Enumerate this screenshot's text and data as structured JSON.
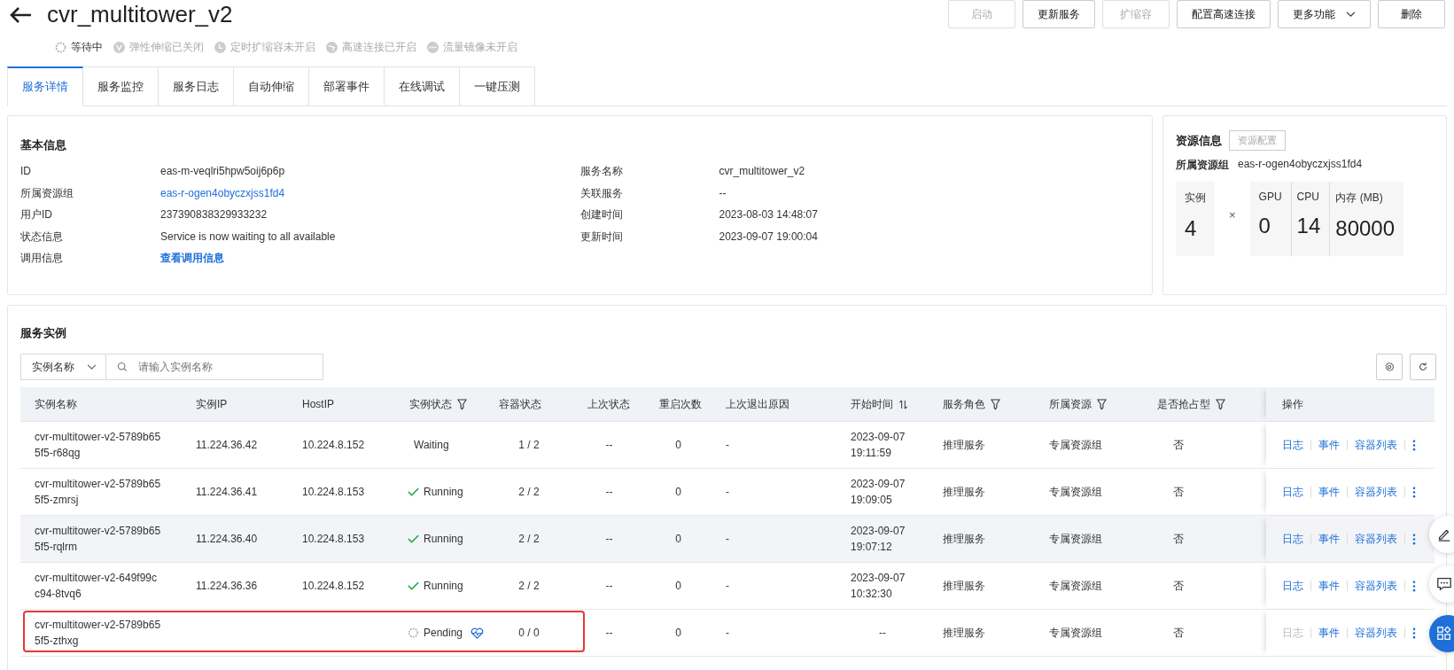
{
  "header": {
    "title": "cvr_multitower_v2",
    "actions": [
      {
        "label": "启动",
        "disabled": true,
        "kind": "button"
      },
      {
        "label": "更新服务",
        "disabled": false,
        "kind": "button"
      },
      {
        "label": "扩缩容",
        "disabled": true,
        "kind": "button"
      },
      {
        "label": "配置高速连接",
        "disabled": false,
        "kind": "button"
      },
      {
        "label": "更多功能",
        "disabled": false,
        "kind": "dropdown"
      },
      {
        "label": "删除",
        "disabled": false,
        "kind": "button"
      }
    ],
    "badges": [
      {
        "label": "等待中",
        "kind": "loading",
        "active": true
      },
      {
        "label": "弹性伸缩已关闭",
        "kind": "scaling",
        "active": false
      },
      {
        "label": "定时扩缩容未开启",
        "kind": "timer",
        "active": false
      },
      {
        "label": "高速连接已开启",
        "kind": "link",
        "active": false
      },
      {
        "label": "流量镜像未开启",
        "kind": "mirror",
        "active": false
      }
    ]
  },
  "tabs": [
    {
      "label": "服务详情",
      "selected": true
    },
    {
      "label": "服务监控",
      "selected": false
    },
    {
      "label": "服务日志",
      "selected": false
    },
    {
      "label": "自动伸缩",
      "selected": false
    },
    {
      "label": "部署事件",
      "selected": false
    },
    {
      "label": "在线调试",
      "selected": false
    },
    {
      "label": "一键压测",
      "selected": false
    }
  ],
  "basic_info": {
    "title": "基本信息",
    "left": [
      {
        "label": "ID",
        "value": "eas-m-veqlri5hpw5oij6p6p",
        "kind": "text"
      },
      {
        "label": "所属资源组",
        "value": "eas-r-ogen4obyczxjss1fd4",
        "kind": "link"
      },
      {
        "label": "用户ID",
        "value": "237390838329933232",
        "kind": "text"
      },
      {
        "label": "状态信息",
        "value": "Service is now waiting to all available",
        "kind": "text"
      },
      {
        "label": "调用信息",
        "value": "查看调用信息",
        "kind": "action"
      }
    ],
    "right": [
      {
        "label": "服务名称",
        "value": "cvr_multitower_v2",
        "kind": "text"
      },
      {
        "label": "关联服务",
        "value": "--",
        "kind": "text"
      },
      {
        "label": "创建时间",
        "value": "2023-08-03 14:48:07",
        "kind": "text"
      },
      {
        "label": "更新时间",
        "value": "2023-09-07 19:00:04",
        "kind": "text"
      }
    ]
  },
  "resource_info": {
    "title": "资源信息",
    "config_button": {
      "label": "资源配置",
      "disabled": true
    },
    "group_label": "所属资源组",
    "group_value": "eas-r-ogen4obyczxjss1fd4",
    "instances": {
      "label": "实例",
      "value": "4"
    },
    "multiply": "×",
    "specs": [
      {
        "label": "GPU",
        "value": "0"
      },
      {
        "label": "CPU",
        "value": "14"
      },
      {
        "label": "内存 (MB)",
        "value": "80000"
      }
    ]
  },
  "instances": {
    "title": "服务实例",
    "filter_select": "实例名称",
    "search_placeholder": "请输入实例名称",
    "columns": [
      {
        "label": "实例名称",
        "filter": false,
        "sort": false
      },
      {
        "label": "实例IP",
        "filter": false,
        "sort": false
      },
      {
        "label": "HostIP",
        "filter": false,
        "sort": false
      },
      {
        "label": "实例状态",
        "filter": true,
        "sort": false
      },
      {
        "label": "容器状态",
        "filter": false,
        "sort": false
      },
      {
        "label": "上次状态",
        "filter": false,
        "sort": false
      },
      {
        "label": "重启次数",
        "filter": false,
        "sort": false
      },
      {
        "label": "上次退出原因",
        "filter": false,
        "sort": false
      },
      {
        "label": "开始时间",
        "filter": false,
        "sort": true
      },
      {
        "label": "服务角色",
        "filter": true,
        "sort": false
      },
      {
        "label": "所属资源",
        "filter": true,
        "sort": false
      },
      {
        "label": "是否抢占型",
        "filter": true,
        "sort": false
      }
    ],
    "action_column": "操作",
    "rows": [
      {
        "name": "cvr-multitower-v2-5789b655f5-r68qg",
        "ip": "11.224.36.42",
        "host_ip": "10.224.8.152",
        "status": {
          "kind": "waiting",
          "label": "Waiting"
        },
        "health_icon": false,
        "containers": "1 / 2",
        "last_status": "--",
        "restarts": "0",
        "exit_reason": "-",
        "start_time": "2023-09-07 19:11:59",
        "role": "推理服务",
        "resource": "专属资源组",
        "preemptible": "否",
        "hovered": false,
        "highlighted": false,
        "actions": [
          {
            "label": "日志",
            "disabled": false
          },
          {
            "label": "事件",
            "disabled": false
          },
          {
            "label": "容器列表",
            "disabled": false
          }
        ]
      },
      {
        "name": "cvr-multitower-v2-5789b655f5-zmrsj",
        "ip": "11.224.36.41",
        "host_ip": "10.224.8.153",
        "status": {
          "kind": "running",
          "label": "Running"
        },
        "health_icon": false,
        "containers": "2 / 2",
        "last_status": "--",
        "restarts": "0",
        "exit_reason": "-",
        "start_time": "2023-09-07 19:09:05",
        "role": "推理服务",
        "resource": "专属资源组",
        "preemptible": "否",
        "hovered": false,
        "highlighted": false,
        "actions": [
          {
            "label": "日志",
            "disabled": false
          },
          {
            "label": "事件",
            "disabled": false
          },
          {
            "label": "容器列表",
            "disabled": false
          }
        ]
      },
      {
        "name": "cvr-multitower-v2-5789b655f5-rqlrm",
        "ip": "11.224.36.40",
        "host_ip": "10.224.8.153",
        "status": {
          "kind": "running",
          "label": "Running"
        },
        "health_icon": false,
        "containers": "2 / 2",
        "last_status": "--",
        "restarts": "0",
        "exit_reason": "-",
        "start_time": "2023-09-07 19:07:12",
        "role": "推理服务",
        "resource": "专属资源组",
        "preemptible": "否",
        "hovered": true,
        "highlighted": false,
        "actions": [
          {
            "label": "日志",
            "disabled": false
          },
          {
            "label": "事件",
            "disabled": false
          },
          {
            "label": "容器列表",
            "disabled": false
          }
        ]
      },
      {
        "name": "cvr-multitower-v2-649f99cc94-8tvq6",
        "ip": "11.224.36.36",
        "host_ip": "10.224.8.152",
        "status": {
          "kind": "running",
          "label": "Running"
        },
        "health_icon": false,
        "containers": "2 / 2",
        "last_status": "--",
        "restarts": "0",
        "exit_reason": "-",
        "start_time": "2023-09-07 10:32:30",
        "role": "推理服务",
        "resource": "专属资源组",
        "preemptible": "否",
        "hovered": false,
        "highlighted": false,
        "actions": [
          {
            "label": "日志",
            "disabled": false
          },
          {
            "label": "事件",
            "disabled": false
          },
          {
            "label": "容器列表",
            "disabled": false
          }
        ]
      },
      {
        "name": "cvr-multitower-v2-5789b655f5-zthxg",
        "ip": "",
        "host_ip": "",
        "status": {
          "kind": "pending",
          "label": "Pending"
        },
        "health_icon": true,
        "containers": "0 / 0",
        "last_status": "--",
        "restarts": "0",
        "exit_reason": "-",
        "start_time": "--",
        "role": "推理服务",
        "resource": "专属资源组",
        "preemptible": "否",
        "hovered": false,
        "highlighted": true,
        "actions": [
          {
            "label": "日志",
            "disabled": true
          },
          {
            "label": "事件",
            "disabled": false
          },
          {
            "label": "容器列表",
            "disabled": false
          }
        ]
      }
    ]
  }
}
